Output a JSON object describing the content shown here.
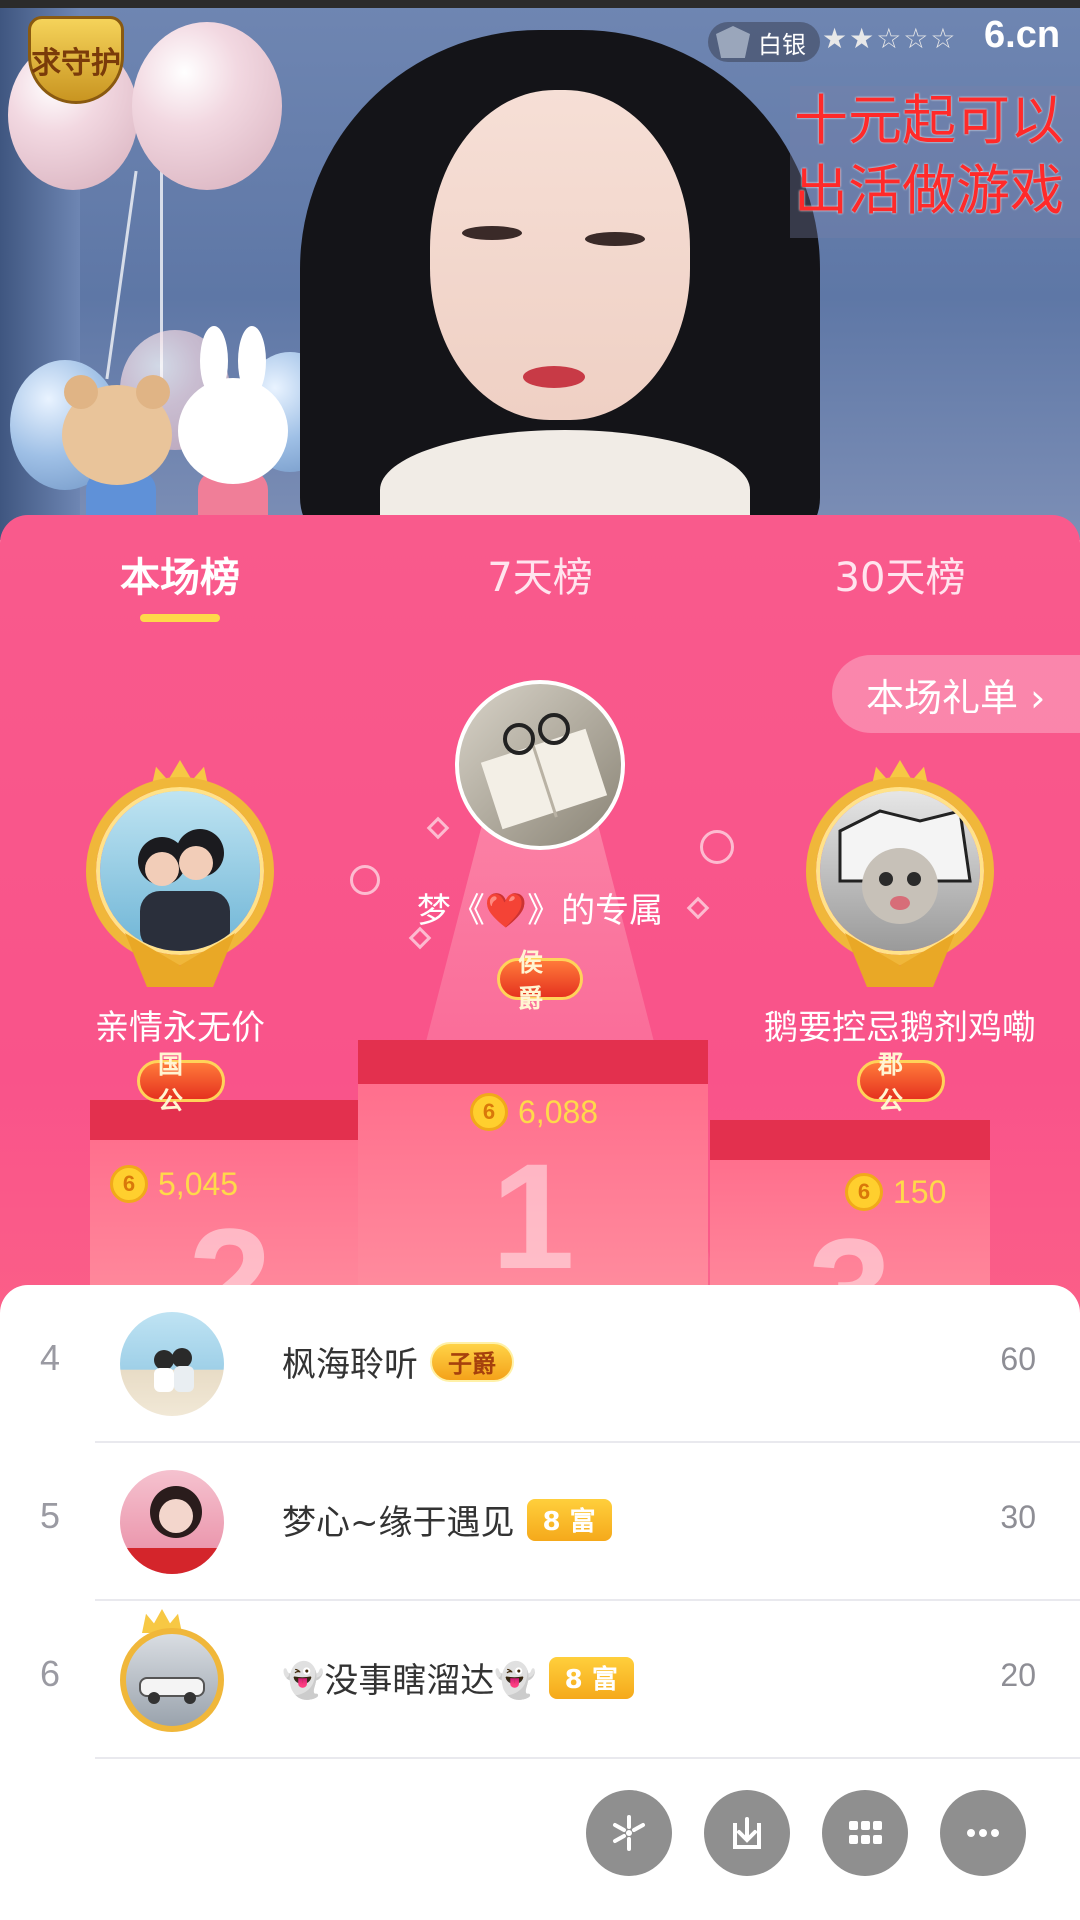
{
  "video": {
    "guard_badge": "求守护",
    "rank_chip": "白银",
    "stars": "★★☆☆☆",
    "brand": "6.cn",
    "overlay_lines": [
      "十元起可以",
      "出活做游戏"
    ]
  },
  "tabs": [
    {
      "label": "本场榜",
      "active": true
    },
    {
      "label": "7天榜",
      "active": false
    },
    {
      "label": "30天榜",
      "active": false
    }
  ],
  "gift_list_button": "本场礼单 ›",
  "podium": {
    "first": {
      "name": "梦《❤️》的专属",
      "badge": "侯爵",
      "score": "6,088",
      "place": "1"
    },
    "second": {
      "name": "亲情永无价",
      "badge": "国公",
      "score": "5,045",
      "place": "2"
    },
    "third": {
      "name": "鹅要控忌鹅剂鸡嘞",
      "badge": "郡公",
      "score": "150",
      "place": "3"
    }
  },
  "coin_symbol": "6",
  "list": [
    {
      "rank": "4",
      "name": "枫海聆听",
      "tag": "子爵",
      "tag_type": "rank",
      "score": "60"
    },
    {
      "rank": "5",
      "name": "梦心~缘于遇见",
      "tag": "8 富",
      "tag_type": "gold",
      "score": "30"
    },
    {
      "rank": "6",
      "name": "👻没事瞎溜达👻",
      "tag": "8 富",
      "tag_type": "gold",
      "score": "20"
    }
  ],
  "fab_icons": [
    "share-icon",
    "download-icon",
    "grid-icon",
    "more-icon"
  ],
  "colors": {
    "panel_pink": "#f95a8c",
    "tab_indicator": "#ffd84a",
    "coin": "#ffcf2e",
    "gold_tag": "#f5a91b"
  }
}
